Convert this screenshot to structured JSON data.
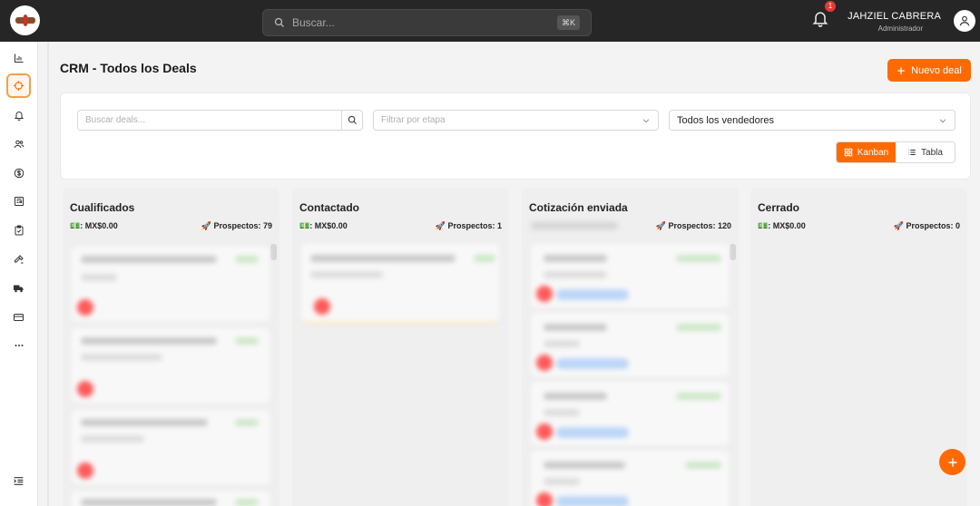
{
  "topbar": {
    "search_placeholder": "Buscar...",
    "shortcut": "⌘K",
    "notification_count": "1",
    "user_name": "JAHZIEL CABRERA",
    "user_role": "Administrador"
  },
  "sidebar": {
    "items": [
      {
        "icon": "bar-chart-icon"
      },
      {
        "icon": "crosshair-icon",
        "active": true
      },
      {
        "icon": "bell-icon"
      },
      {
        "icon": "users-icon"
      },
      {
        "icon": "dollar-icon"
      },
      {
        "icon": "news-icon"
      },
      {
        "icon": "clipboard-check-icon"
      },
      {
        "icon": "tools-icon"
      },
      {
        "icon": "truck-icon"
      },
      {
        "icon": "credit-card-icon"
      },
      {
        "icon": "more-icon"
      }
    ],
    "collapse_icon": "collapse-menu-icon"
  },
  "main": {
    "title": "CRM - Todos los Deals",
    "new_deal_label": "Nuevo deal",
    "filters": {
      "search_placeholder": "Buscar deals...",
      "stage_placeholder": "Filtrar por etapa",
      "seller_value": "Todos los vendedores"
    },
    "views": {
      "kanban_label": "Kanban",
      "table_label": "Tabla",
      "active": "kanban"
    }
  },
  "columns": [
    {
      "title": "Cualificados",
      "total": "💵: MX$0.00",
      "count": "🚀 Prospectos: 79"
    },
    {
      "title": "Contactado",
      "total": "💵: MX$0.00",
      "count": "🚀 Prospectos: 1"
    },
    {
      "title": "Cotización enviada",
      "total": "",
      "count": "🚀 Prospectos: 120"
    },
    {
      "title": "Cerrado",
      "total": "💵: MX$0.00",
      "count": "🚀 Prospectos: 0"
    }
  ],
  "colors": {
    "accent": "#ff6a00",
    "topbar": "#262626"
  }
}
